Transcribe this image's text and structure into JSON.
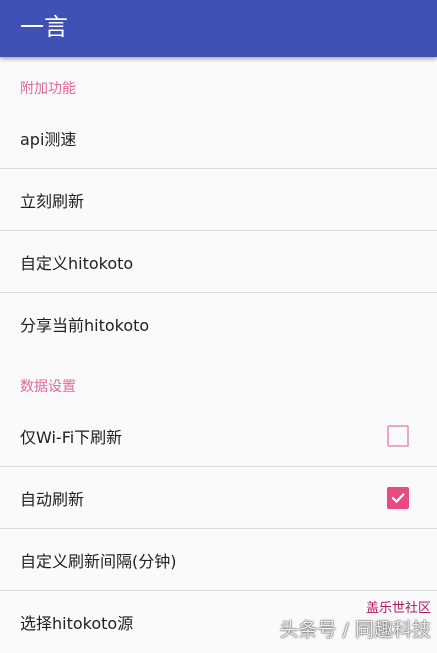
{
  "appbar": {
    "title": "一言"
  },
  "groups": [
    {
      "category": "附加功能",
      "items": [
        {
          "title": "api测速"
        },
        {
          "title": "立刻刷新"
        },
        {
          "title": "自定义hitokoto"
        },
        {
          "title": "分享当前hitokoto"
        }
      ]
    },
    {
      "category": "数据设置",
      "items": [
        {
          "title": "仅Wi-Fi下刷新",
          "checked": false
        },
        {
          "title": "自动刷新",
          "checked": true
        },
        {
          "title": "自定义刷新间隔(分钟)"
        },
        {
          "title": "选择hitokoto源"
        }
      ]
    }
  ],
  "colors": {
    "appbar": "#3f51b5",
    "accent": "#e84a82",
    "category_text": "#e06a9a"
  },
  "watermark": {
    "text": "头条号 / 同趣科技",
    "badge": "盖乐世社区"
  }
}
